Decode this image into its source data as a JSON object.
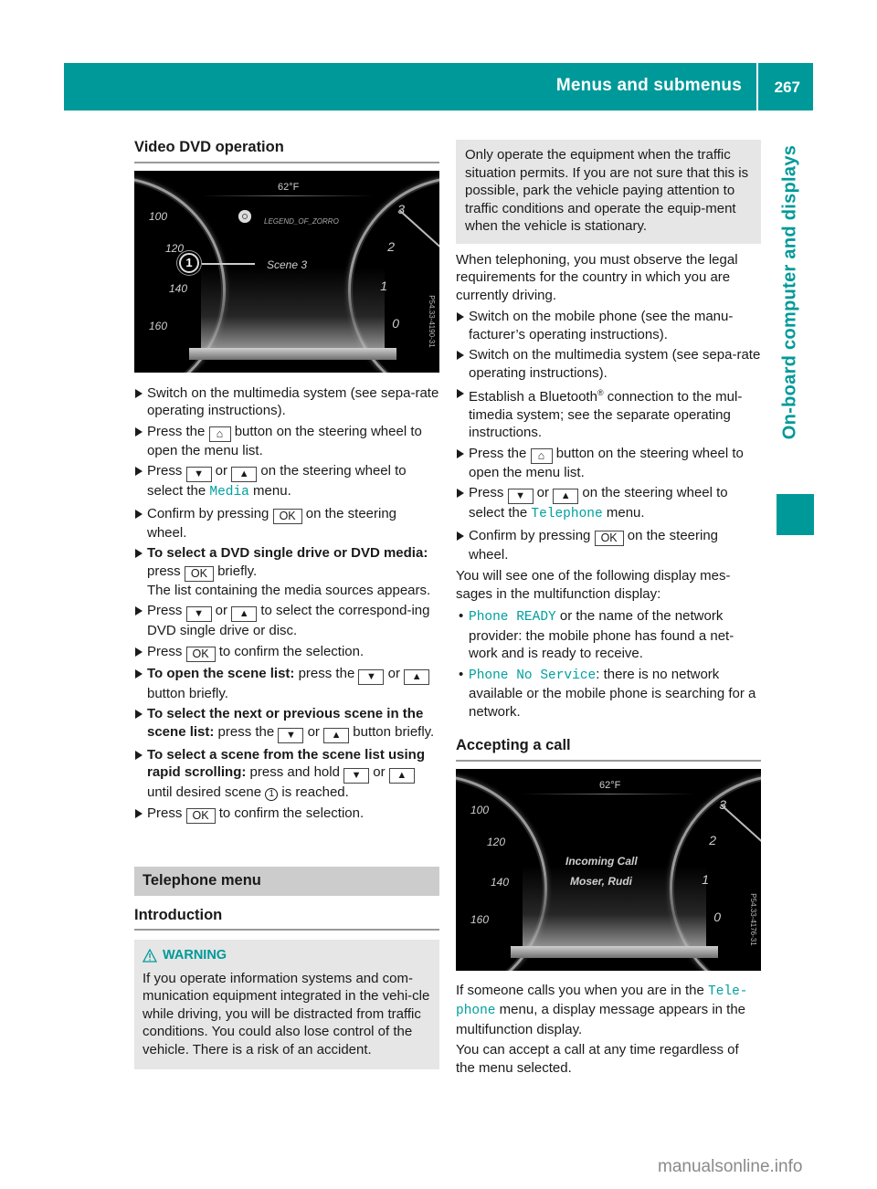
{
  "header": {
    "title": "Menus and submenus",
    "page_number": "267",
    "side_tab": "On-board computer and displays",
    "accent_color": "#009999"
  },
  "left_column": {
    "section_title": "Video DVD operation",
    "illustration": {
      "temperature": "62°F",
      "track_title": "LEGEND_OF_ZORRO",
      "scene_label": "Scene 3",
      "callout": "1",
      "speed_ticks": [
        "100",
        "120",
        "140",
        "160"
      ],
      "rpm_ticks": [
        "3",
        "2",
        "1",
        "0"
      ],
      "image_code": "P54.33-4190-31"
    },
    "steps": [
      {
        "t1": "Switch on the multimedia system (see sepa-rate operating instructions)."
      },
      {
        "t1": "Press the ",
        "key": "home",
        "t2": " button on the steering wheel to open the menu list."
      },
      {
        "t1": "Press ",
        "or": " or ",
        "t2": " on the steering wheel to select the ",
        "menu": "Media",
        "t3": " menu."
      },
      {
        "t1": "Confirm by pressing ",
        "key": "OK",
        "t2": " on the steering wheel."
      },
      {
        "bold": "To select a DVD single drive or DVD media:",
        "t1": " press ",
        "key": "OK",
        "t2": " briefly.",
        "t3": "The list containing the media sources appears."
      },
      {
        "t1": "Press ",
        "or": " or ",
        "t2": " to select the correspond-ing DVD single drive or disc."
      },
      {
        "t1": "Press ",
        "key": "OK",
        "t2": " to confirm the selection."
      },
      {
        "bold": "To open the scene list:",
        "t1": " press the ",
        "or": " or ",
        "t2": " button briefly."
      },
      {
        "bold": "To select the next or previous scene in the scene list:",
        "t1": " press the ",
        "or": " or ",
        "t2": " button briefly."
      },
      {
        "bold": "To select a scene from the scene list using rapid scrolling:",
        "t1": " press and hold ",
        "or": " or ",
        "t2": " until desired scene ",
        "num": "1",
        "t3": " is reached."
      },
      {
        "t1": "Press ",
        "key": "OK",
        "t2": " to confirm the selection."
      }
    ],
    "telephone_menu_title": "Telephone menu",
    "introduction_title": "Introduction",
    "warning": {
      "title": "WARNING",
      "text": "If you operate information systems and com-munication equipment integrated in the vehi-cle while driving, you will be distracted from traffic conditions. You could also lose control of the vehicle. There is a risk of an accident."
    }
  },
  "right_column": {
    "warning_continued": "Only operate the equipment when the traffic situation permits. If you are not sure that this is possible, park the vehicle paying attention to traffic conditions and operate the equip-ment when the vehicle is stationary.",
    "legal_note": "When telephoning, you must observe the legal requirements for the country in which you are currently driving.",
    "steps": [
      {
        "t1": "Switch on the mobile phone (see the manu-facturer’s operating instructions)."
      },
      {
        "t1": "Switch on the multimedia system (see sepa-rate operating instructions)."
      },
      {
        "t1": "Establish a Bluetooth",
        "sup": "®",
        "t2": " connection to the mul-timedia system; see the separate operating instructions."
      },
      {
        "t1": "Press the ",
        "key": "home",
        "t2": " button on the steering wheel to open the menu list."
      },
      {
        "t1": "Press ",
        "or": " or ",
        "t2": " on the steering wheel to select the ",
        "menu": "Telephone",
        "t3": " menu."
      },
      {
        "t1": "Confirm by pressing ",
        "key": "OK",
        "t2": " on the steering wheel."
      }
    ],
    "display_intro": "You will see one of the following display mes-sages in the multifunction display:",
    "display_messages": [
      {
        "code": "Phone READY",
        "text": " or the name of the network provider: the mobile phone has found a net-work and is ready to receive."
      },
      {
        "code": "Phone No Service",
        "text": ": there is no network available or the mobile phone is searching for a network."
      }
    ],
    "accepting_title": "Accepting a call",
    "illustration": {
      "temperature": "62°F",
      "line1": "Incoming Call",
      "line2": "Moser, Rudi",
      "speed_ticks": [
        "100",
        "120",
        "140",
        "160"
      ],
      "rpm_ticks": [
        "3",
        "2",
        "1",
        "0"
      ],
      "image_code": "P54.33-4176-31"
    },
    "accept_p1_a": "If someone calls you when you are in the ",
    "accept_p1_menu": "Tele-phone",
    "accept_p1_b": " menu, a display message appears in the multifunction display.",
    "accept_p2": "You can accept a call at any time regardless of the menu selected."
  },
  "keys": {
    "down": "▼",
    "up": "▲",
    "ok": "OK",
    "home": "⌂"
  },
  "watermark": "manualsonline.info"
}
